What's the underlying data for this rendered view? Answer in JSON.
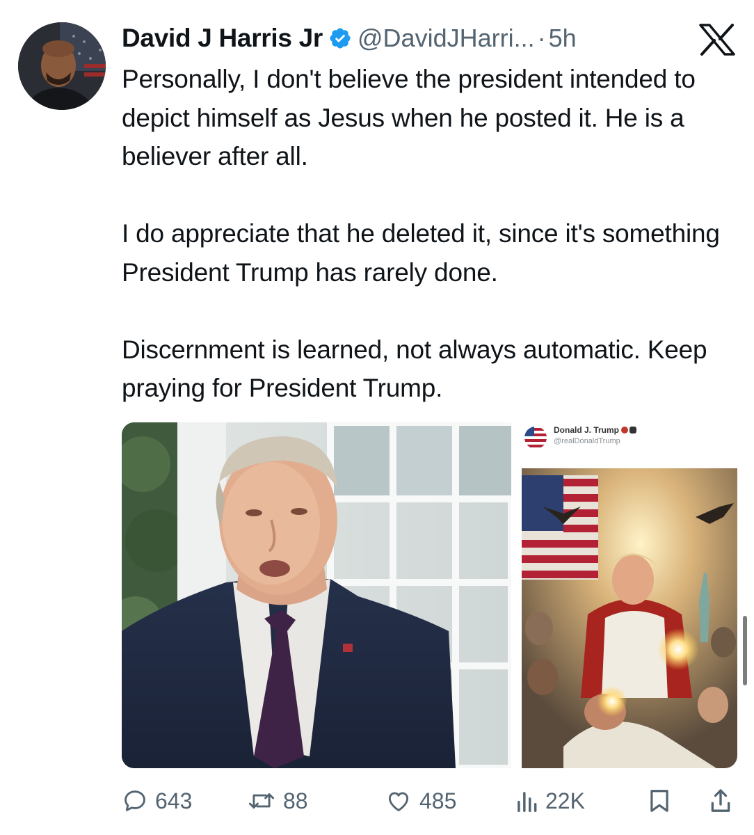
{
  "tweet": {
    "author": {
      "display_name": "David J Harris Jr",
      "handle": "@DavidJHarri...",
      "verified": true,
      "avatar_icon": "avatar-photo"
    },
    "separator": "·",
    "timestamp": "5h",
    "platform_icon": "x-logo-icon",
    "paragraphs": [
      "Personally, I don't believe the president intended to depict himself as Jesus when he posted it. He is a believer after all.",
      "I do appreciate that he deleted it, since it's something President Trump has rarely done.",
      "Discernment is learned, not always automatic. Keep praying for President Trump."
    ],
    "media": {
      "left_photo_icon": "photo-man-in-suit",
      "embedded_post": {
        "name": "Donald J. Trump",
        "handle": "@realDonaldTrump",
        "image_icon": "painting-image"
      }
    },
    "actions": {
      "replies": "643",
      "reposts": "88",
      "likes": "485",
      "views": "22K"
    }
  },
  "colors": {
    "text": "#0f1419",
    "secondary": "#536471",
    "verified": "#1d9bf0",
    "background": "#ffffff"
  }
}
